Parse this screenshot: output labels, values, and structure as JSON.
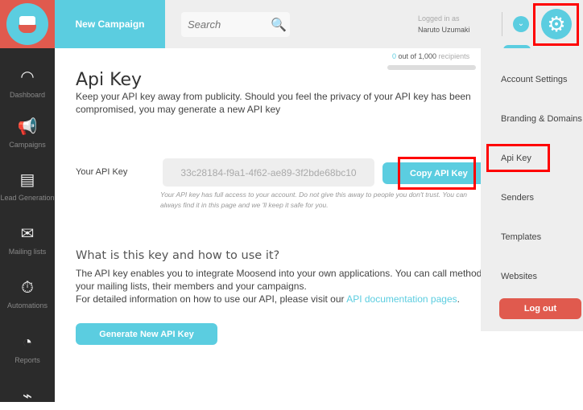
{
  "header": {
    "new_campaign": "New Campaign",
    "search_placeholder": "Search",
    "logged_in_label": "Logged in as",
    "user_name": "Naruto Uzumaki"
  },
  "sidebar": {
    "items": [
      {
        "label": "Dashboard",
        "icon": "gauge-icon"
      },
      {
        "label": "Campaigns",
        "icon": "megaphone-icon"
      },
      {
        "label": "Lead Generation",
        "icon": "form-icon"
      },
      {
        "label": "Mailing lists",
        "icon": "envelope-icon"
      },
      {
        "label": "Automations",
        "icon": "stopwatch-icon"
      },
      {
        "label": "Reports",
        "icon": "pie-chart-icon"
      }
    ]
  },
  "recipients": {
    "count": "0",
    "text": " out of 1,000 ",
    "suffix": "recipients",
    "fraction": 0
  },
  "main": {
    "title": "Api Key",
    "intro": "Keep your API key away from publicity. Should you feel the privacy of your API key has been compromised, you may generate a new API key",
    "key_label": "Your API Key",
    "key_value": "33c28184-f9a1-4f62-ae89-3f2bde68bc10",
    "copy_button": "Copy API Key",
    "hint": "Your API key has full access to your account. Do not give this away to people you don't trust. You can always find it in this page and we 'll keep it safe for you.",
    "section_title": "What is this key and how to use it?",
    "section_p1": "The API key enables you to integrate Moosend into your own applications. You can call methods to manage",
    "section_p2": "your mailing lists, their members and your campaigns.",
    "section_p3": "For detailed information on how to use our API, please visit our ",
    "doc_link": "API documentation pages",
    "period": ".",
    "generate_button": "Generate New API Key"
  },
  "menu": {
    "items": [
      "Account Settings",
      "Branding & Domains",
      "Api Key",
      "Senders",
      "Templates",
      "Websites"
    ],
    "logout": "Log out"
  },
  "colors": {
    "accent": "#5bcde0",
    "brand_red": "#e05a4e",
    "highlight": "#ff0000"
  }
}
